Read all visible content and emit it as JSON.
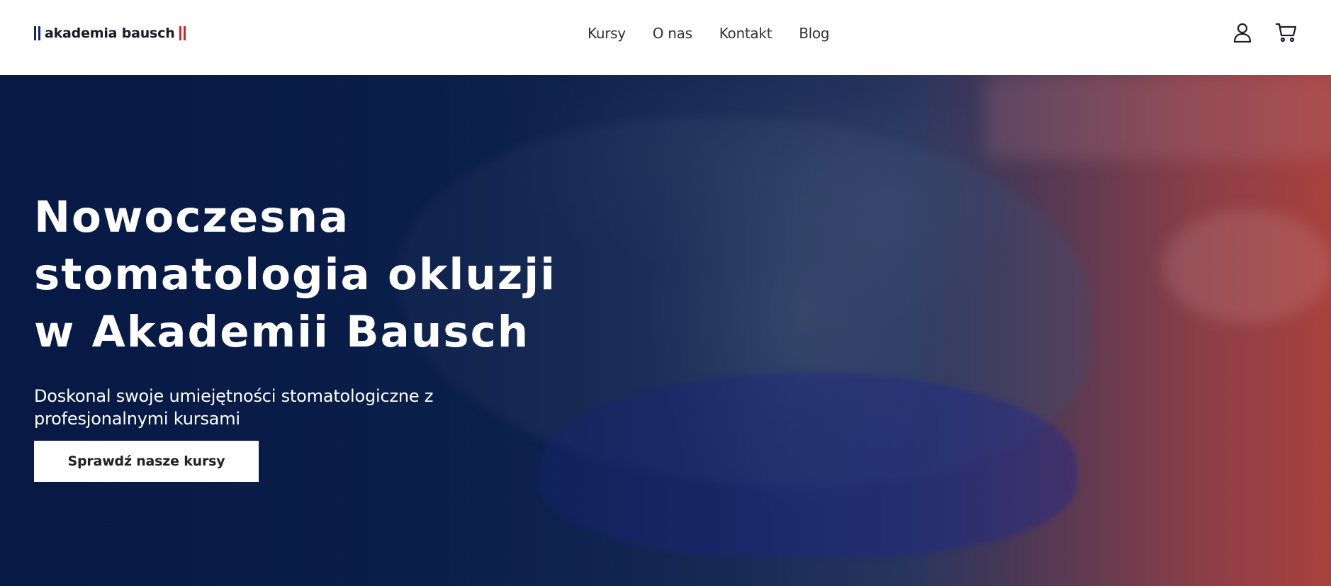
{
  "header": {
    "logo_text": "akademia bausch",
    "nav": [
      {
        "label": "Kursy"
      },
      {
        "label": "O nas"
      },
      {
        "label": "Kontakt"
      },
      {
        "label": "Blog"
      }
    ],
    "icons": [
      "user-icon",
      "cart-icon"
    ]
  },
  "hero": {
    "title_lines": [
      "Nowoczesna",
      "stomatologia okluzji",
      "w Akademii Bausch"
    ],
    "subtitle": "Doskonal swoje umiejętności stomatologiczne z profesjonalnymi kursami",
    "cta_label": "Sprawdź nasze kursy"
  },
  "colors": {
    "brand_navy": "#0d2a66",
    "brand_red": "#d6202a",
    "hero_dark": "#071a45",
    "hero_red": "#a9413e"
  }
}
